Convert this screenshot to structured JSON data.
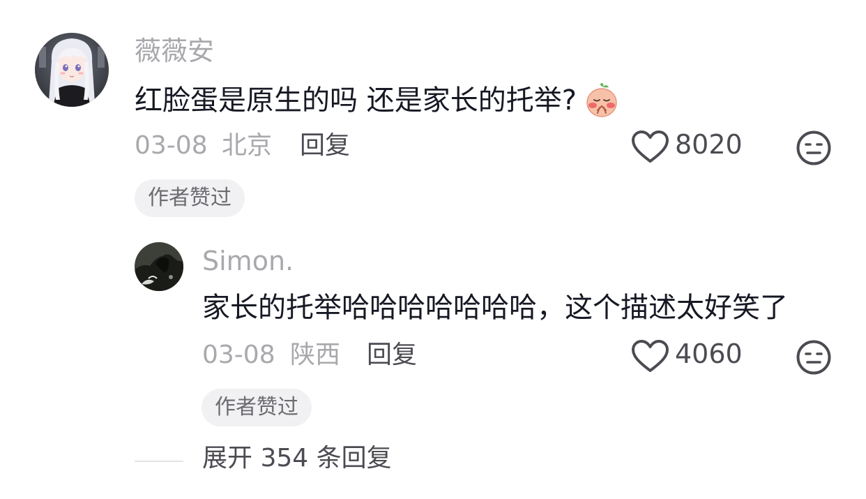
{
  "comments": [
    {
      "avatar_icon": "anime-girl-avatar",
      "username": "薇薇安",
      "text": "红脸蛋是原生的吗 还是家长的托举?",
      "emoji_icon": "peach-shy-emoji",
      "date": "03-08",
      "location": "北京",
      "reply_label": "回复",
      "like_icon": "heart-outline-icon",
      "likes": "8020",
      "dislike_icon": "meh-face-icon",
      "badge": "作者赞过"
    },
    {
      "avatar_icon": "dark-horse-avatar",
      "username": "Simon.",
      "text": "家长的托举哈哈哈哈哈哈哈，这个描述太好笑了",
      "date": "03-08",
      "location": "陕西",
      "reply_label": "回复",
      "like_icon": "heart-outline-icon",
      "likes": "4060",
      "dislike_icon": "meh-face-icon",
      "badge": "作者赞过"
    }
  ],
  "expand_label": "展开 354 条回复",
  "colors": {
    "primary_text": "#161823",
    "secondary_text": "#a8a8ad",
    "action_text": "#4b4b52",
    "badge_bg": "#f1f1f3"
  }
}
